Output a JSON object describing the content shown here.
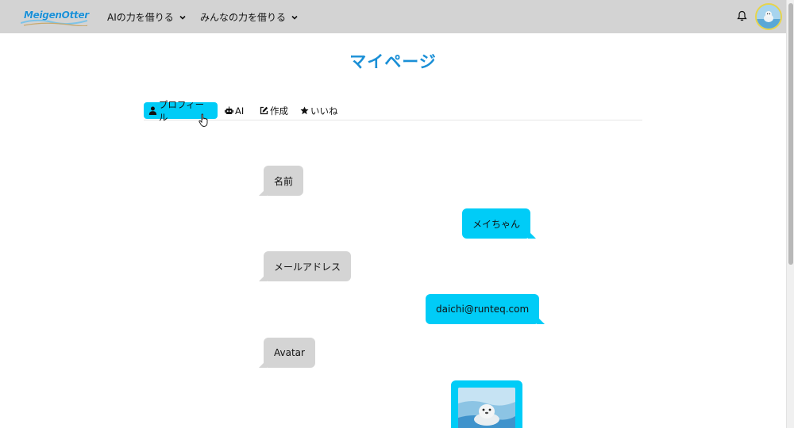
{
  "navbar": {
    "logo_text": "MeigenOtter",
    "menus": [
      {
        "label": "AIの力を借りる"
      },
      {
        "label": "みんなの力を借りる"
      }
    ]
  },
  "page": {
    "title": "マイページ"
  },
  "tabs": [
    {
      "label": "プロフィール",
      "icon": "user-icon",
      "active": true
    },
    {
      "label": "AI",
      "icon": "robot-icon",
      "active": false
    },
    {
      "label": "作成",
      "icon": "edit-icon",
      "active": false
    },
    {
      "label": "いいね",
      "icon": "star-icon",
      "active": false
    }
  ],
  "profile": {
    "name_label": "名前",
    "name_value": "メイちゃん",
    "email_label": "メールアドレス",
    "email_value": "daichi@runteq.com",
    "avatar_label": "Avatar"
  },
  "colors": {
    "navbar_bg": "#d3d3d3",
    "accent": "#00ccf7",
    "title": "#1a8fd6",
    "bubble_left": "#d4d4d4"
  }
}
